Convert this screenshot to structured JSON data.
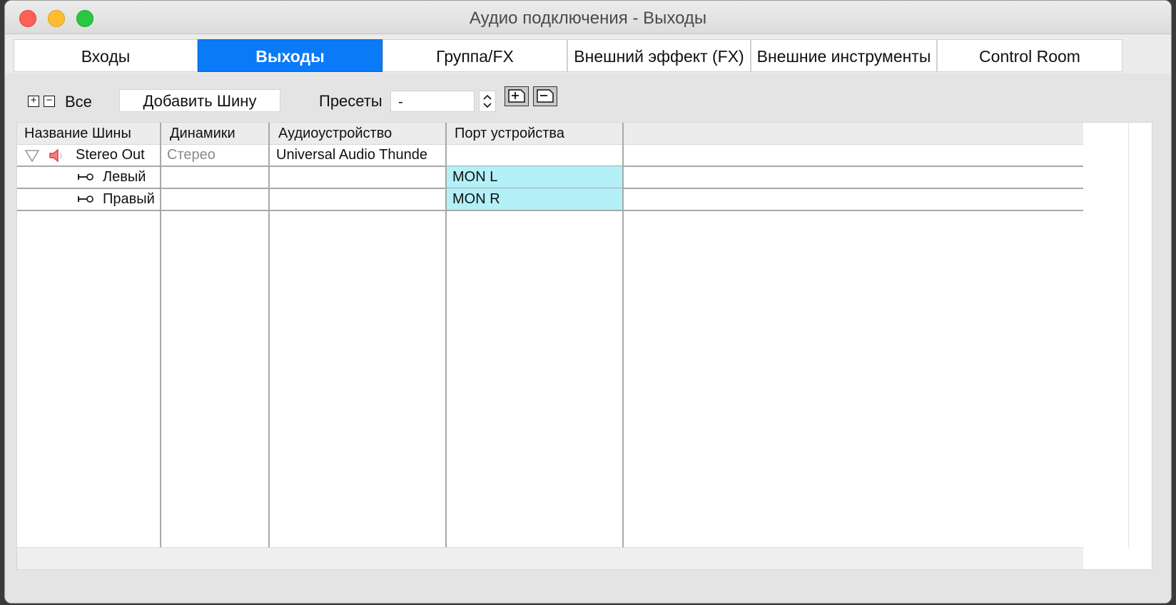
{
  "window": {
    "title": "Аудио подключения - Выходы"
  },
  "tabs": [
    {
      "label": "Входы",
      "active": false
    },
    {
      "label": "Выходы",
      "active": true
    },
    {
      "label": "Группа/FX",
      "active": false
    },
    {
      "label": "Внешний эффект (FX)",
      "active": false
    },
    {
      "label": "Внешние инструменты",
      "active": false
    },
    {
      "label": "Control Room",
      "active": false
    }
  ],
  "toolbar": {
    "all_label": "Все",
    "add_bus_label": "Добавить Шину",
    "presets_label": "Пресеты",
    "presets_value": "-"
  },
  "table": {
    "headers": [
      "Название Шины",
      "Динамики",
      "Аудиоустройство",
      "Порт устройства"
    ],
    "rows": [
      {
        "name": "Stereo Out",
        "speakers": "Стерео",
        "device": "Universal Audio Thunde",
        "port": ""
      },
      {
        "name": "Левый",
        "speakers": "",
        "device": "",
        "port": "MON L"
      },
      {
        "name": "Правый",
        "speakers": "",
        "device": "",
        "port": "MON R"
      }
    ]
  },
  "colors": {
    "active_tab": "#0a7af7",
    "port_highlight": "#b3f0f8",
    "speaker_icon": "#e53935"
  },
  "icons": {
    "expand": "triangle-down-icon",
    "speaker": "speaker-icon",
    "channel": "channel-connector-icon"
  }
}
